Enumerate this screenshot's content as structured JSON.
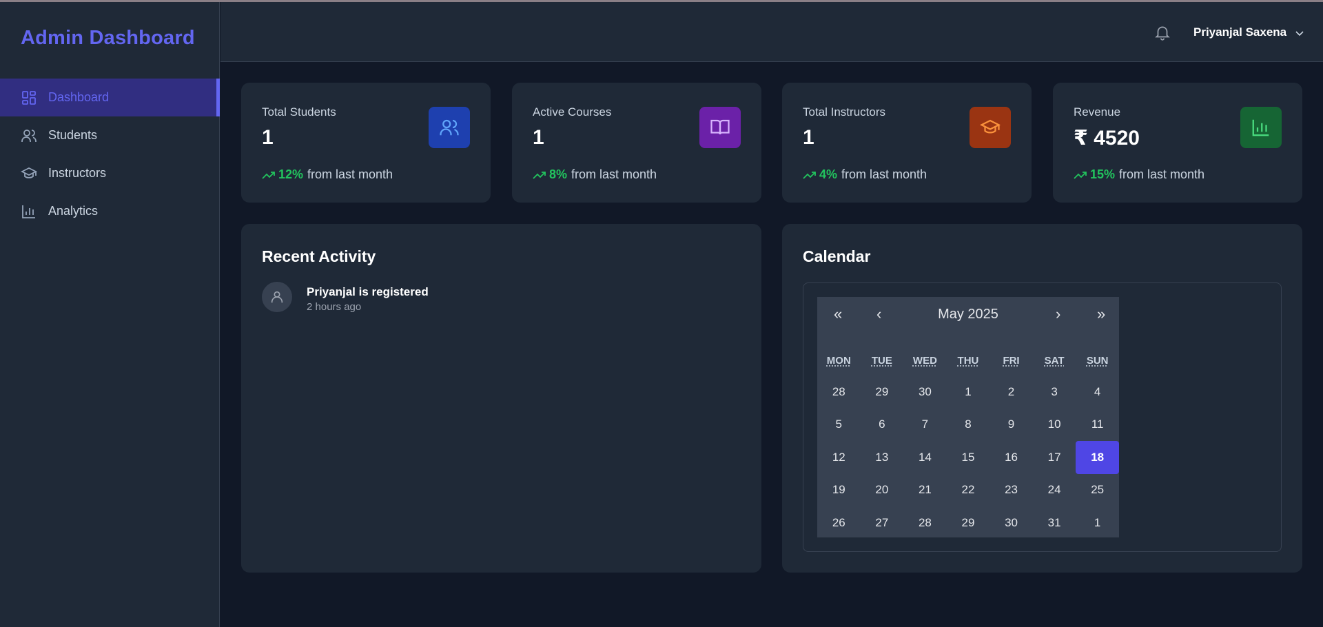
{
  "app": {
    "title": "Admin Dashboard"
  },
  "sidebar": {
    "items": [
      {
        "label": "Dashboard",
        "icon": "dashboard-grid-icon",
        "active": true
      },
      {
        "label": "Students",
        "icon": "users-icon",
        "active": false
      },
      {
        "label": "Instructors",
        "icon": "graduation-cap-icon",
        "active": false
      },
      {
        "label": "Analytics",
        "icon": "bar-chart-icon",
        "active": false
      }
    ]
  },
  "header": {
    "user_name": "Priyanjal Saxena",
    "bell_icon": "bell-icon",
    "dropdown_icon": "chevron-down-icon"
  },
  "stats": [
    {
      "label": "Total Students",
      "value": "1",
      "trend": "12%",
      "trend_text": "from last month",
      "icon": "users-icon",
      "color": "#1e40af"
    },
    {
      "label": "Active Courses",
      "value": "1",
      "trend": "8%",
      "trend_text": "from last month",
      "icon": "book-open-icon",
      "color": "#6b21a8"
    },
    {
      "label": "Total Instructors",
      "value": "1",
      "trend": "4%",
      "trend_text": "from last month",
      "icon": "graduation-cap-icon",
      "color": "#9a3412"
    },
    {
      "label": "Revenue",
      "value": "₹ 4520",
      "trend": "15%",
      "trend_text": "from last month",
      "icon": "bar-chart-icon",
      "color": "#166534"
    }
  ],
  "activity": {
    "title": "Recent Activity",
    "items": [
      {
        "text": "Priyanjal is registered",
        "time": "2 hours ago",
        "icon": "user-icon"
      }
    ]
  },
  "calendar": {
    "title": "Calendar",
    "nav": {
      "prev_year": "«",
      "prev_month": "‹",
      "next_month": "›",
      "next_year": "»"
    },
    "month_label": "May 2025",
    "weekdays": [
      "MON",
      "TUE",
      "WED",
      "THU",
      "FRI",
      "SAT",
      "SUN"
    ],
    "weeks": [
      [
        "28",
        "29",
        "30",
        "1",
        "2",
        "3",
        "4"
      ],
      [
        "5",
        "6",
        "7",
        "8",
        "9",
        "10",
        "11"
      ],
      [
        "12",
        "13",
        "14",
        "15",
        "16",
        "17",
        "18"
      ],
      [
        "19",
        "20",
        "21",
        "22",
        "23",
        "24",
        "25"
      ],
      [
        "26",
        "27",
        "28",
        "29",
        "30",
        "31",
        "1"
      ]
    ],
    "selected_day": "18"
  },
  "colors": {
    "accent": "#6366f1",
    "positive": "#22c55e",
    "background": "#111827",
    "surface": "#1f2937"
  }
}
